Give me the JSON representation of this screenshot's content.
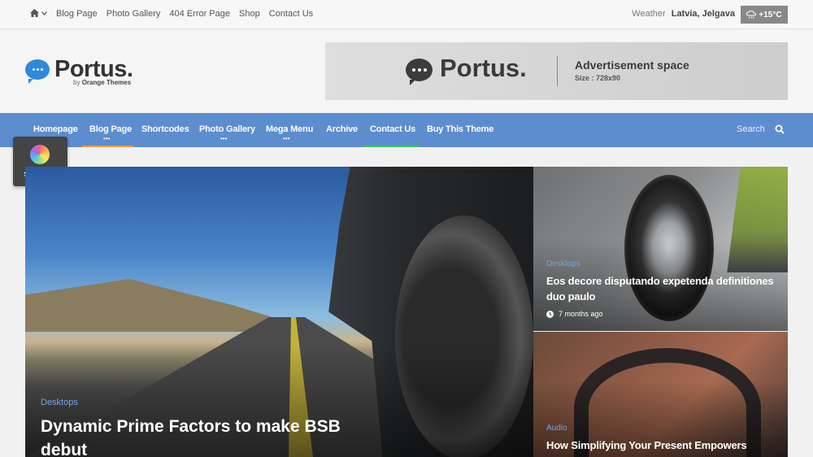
{
  "topbar": {
    "links": [
      "Blog Page",
      "Photo Gallery",
      "404 Error Page",
      "Shop",
      "Contact Us"
    ],
    "weather_label": "Weather",
    "location": "Latvia, Jelgava",
    "temperature": "+15°C"
  },
  "header": {
    "logo_text": "Portus.",
    "logo_by": "by",
    "logo_company": "Orange Themes",
    "ad": {
      "brand": "Portus.",
      "title": "Advertisement space",
      "size": "Size : 728x90"
    }
  },
  "nav": {
    "items": [
      {
        "label": "Homepage"
      },
      {
        "label": "Blog Page"
      },
      {
        "label": "Shortcodes"
      },
      {
        "label": "Photo Gallery"
      },
      {
        "label": "Mega Menu"
      },
      {
        "label": "Archive"
      },
      {
        "label": "Contact Us"
      },
      {
        "label": "Buy This Theme"
      }
    ],
    "search_label": "Search",
    "colors": {
      "bar": "#5c8dcf",
      "blog_underline": "#e8a040",
      "contact_underline": "#3fbf6a"
    }
  },
  "settings": {
    "label": "SETTINGS"
  },
  "main_post": {
    "category": "Desktops",
    "title": "Dynamic Prime Factors to make BSB debut"
  },
  "side_posts": [
    {
      "category": "Desktops",
      "title": "Eos decore disputando expetenda definitiones duo paulo",
      "time": "7 months ago"
    },
    {
      "category": "Audio",
      "title": "How Simplifying Your Present Empowers"
    }
  ]
}
